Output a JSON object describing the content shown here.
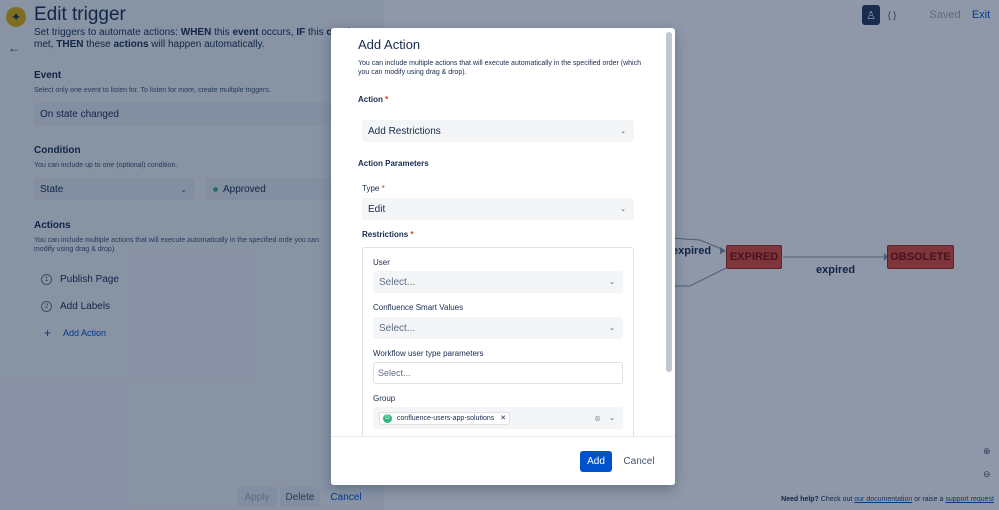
{
  "topbar": {
    "saved_label": "Saved",
    "exit_label": "Exit",
    "user_icon": "user-icon",
    "code_icon": "code-icon"
  },
  "workflow": {
    "statuses": [
      "EXPIRED",
      "OBSOLETE"
    ],
    "transition_labels": [
      "expired",
      "expired"
    ]
  },
  "footer": {
    "need_help": "Need help?",
    "check_out": "Check out",
    "docs_link": "our documentation",
    "or_raise": "or raise a",
    "support_link": "support request"
  },
  "panel": {
    "title": "Edit trigger",
    "desc_parts": [
      "Set triggers to automate actions: ",
      "WHEN",
      " this ",
      "event",
      " occurs, ",
      "IF",
      " this ",
      "cond",
      "met, ",
      "THEN",
      " these ",
      "actions",
      " will happen automatically."
    ],
    "event": {
      "title": "Event",
      "subtitle": "Select only one event to listen for. To listen for more, create multiple triggers.",
      "value": "On state changed"
    },
    "condition": {
      "title": "Condition",
      "subtitle": "You can include up to one (optional) condition.",
      "field": "State",
      "value": "Approved"
    },
    "actions": {
      "title": "Actions",
      "subtitle": "You can include multiple actions that will execute automatically in the specified orde you can modify using drag & drop).",
      "steps": [
        {
          "num": "1",
          "label": "Publish Page"
        },
        {
          "num": "2",
          "label": "Add Labels"
        }
      ],
      "add_label": "Add Action"
    },
    "buttons": {
      "apply": "Apply",
      "delete": "Delete",
      "cancel": "Cancel"
    }
  },
  "modal": {
    "title": "Add Action",
    "desc": "You can include multiple actions that will execute automatically in the specified order (which you can modify using drag & drop).",
    "action_label": "Action",
    "action_value": "Add Restrictions",
    "params_label": "Action Parameters",
    "type_label": "Type",
    "type_value": "Edit",
    "restrictions_label": "Restrictions",
    "user_label": "User",
    "user_placeholder": "Select...",
    "smart_label": "Confluence Smart Values",
    "smart_placeholder": "Select...",
    "wf_param_label": "Workflow user type parameters",
    "wf_param_placeholder": "Select...",
    "group_label": "Group",
    "group_tag": "confluence-users-app-solutions",
    "add_button": "Add",
    "cancel_button": "Cancel"
  }
}
